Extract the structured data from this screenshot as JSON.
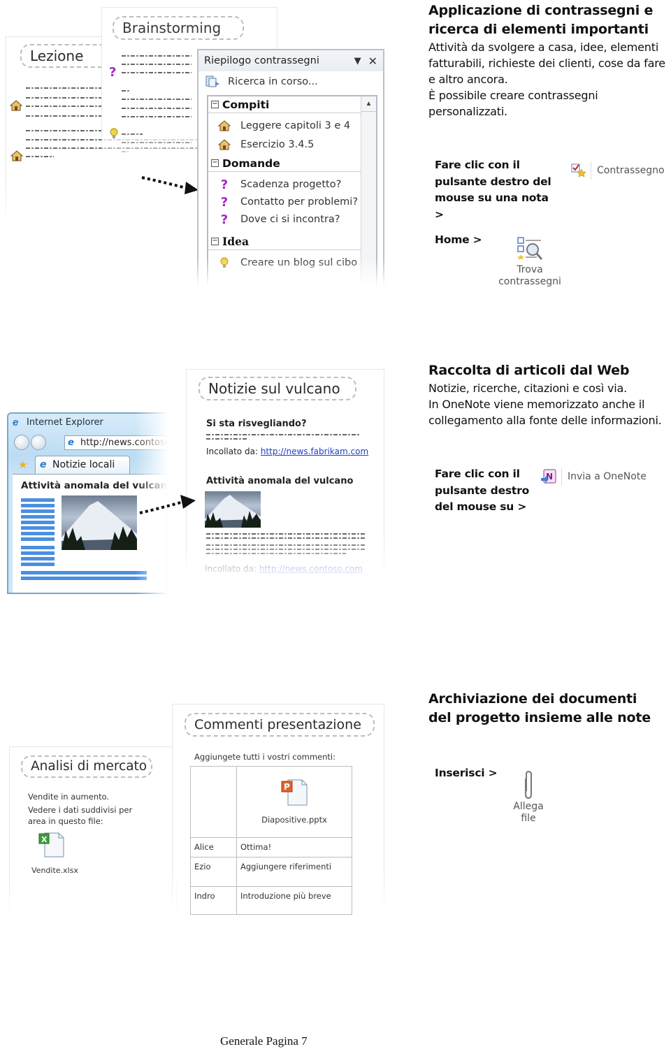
{
  "section1": {
    "heading": "Applicazione di contrassegni e ricerca di elementi importanti",
    "body": [
      "Attività da svolgere a casa, idee, elementi fatturabili, richieste dei clienti, cose da fare e altro ancora.",
      "È possibile creare contrassegni personalizzati."
    ],
    "instruction1": "Fare clic con il pulsante destro del mouse su una nota >",
    "ribbon_button1": {
      "label": "Contrassegno",
      "icon": "tag-checkbox-star-icon"
    },
    "instruction2": "Home >",
    "ribbon_button2": {
      "label_line1": "Trova",
      "label_line2": "contrassegni",
      "icon": "find-tags-icon"
    },
    "illustration": {
      "page_lezione_title": "Lezione",
      "page_brainstorming_title": "Brainstorming",
      "tag_pane": {
        "title": "Riepilogo contrassegni",
        "search_status": "Ricerca in corso...",
        "groups": [
          {
            "name": "Compiti",
            "items": [
              "Leggere capitoli 3 e 4",
              "Esercizio 3.4.5"
            ],
            "icon": "house-icon"
          },
          {
            "name": "Domande",
            "items": [
              "Scadenza progetto?",
              "Contatto per problemi?",
              "Dove ci si incontra?"
            ],
            "icon": "question-icon"
          },
          {
            "name": "Idea",
            "items": [
              "Creare un blog sul cibo"
            ],
            "icon": "lightbulb-icon"
          }
        ]
      }
    }
  },
  "section2": {
    "heading": "Raccolta di articoli dal Web",
    "body": [
      "Notizie, ricerche, citazioni e così via.",
      "In OneNote viene memorizzato anche il collegamento alla fonte delle informazioni."
    ],
    "instruction": "Fare clic con il pulsante destro del mouse su >",
    "ribbon_button": {
      "label": "Invia a OneNote",
      "icon": "onenote-icon"
    },
    "illustration": {
      "browser": {
        "app_title": "Internet Explorer",
        "address": "http://news.contoso.c",
        "tab_label": "Notizie locali",
        "article_title": "Attività anomala del vulcano"
      },
      "onenote_page": {
        "title": "Notizie sul vulcano",
        "clip1_heading": "Si sta risvegliando?",
        "clip1_source_label": "Incollato  da:",
        "clip1_source_url": "http://news.fabrikam.com",
        "clip2_heading": "Attività anomala del vulcano",
        "clip2_source_label": "Incollato  da:",
        "clip2_source_url": "http://news.contoso.com"
      }
    }
  },
  "section3": {
    "heading": "Archiviazione dei documenti del progetto insieme alle note",
    "instruction": "Inserisci >",
    "ribbon_button": {
      "label_line1": "Allega",
      "label_line2": "file",
      "icon": "paperclip-icon"
    },
    "illustration": {
      "market_page": {
        "title": "Analisi di mercato",
        "line1": "Vendite in aumento.",
        "line2": "Vedere i dati suddivisi  per area in questo  file:",
        "file_name": "Vendite.xlsx"
      },
      "comments_page": {
        "title": "Commenti presentazione",
        "intro": "Aggiungete  tutti i vostri  commenti:",
        "file_name": "Diapositive.pptx",
        "rows": [
          {
            "name": "Alice",
            "comment": "Ottima!"
          },
          {
            "name": "Ezio",
            "comment": "Aggiungere  riferimenti"
          },
          {
            "name": "Indro",
            "comment": "Introduzione  più  breve"
          }
        ]
      }
    }
  },
  "footer": "Generale Pagina 7"
}
